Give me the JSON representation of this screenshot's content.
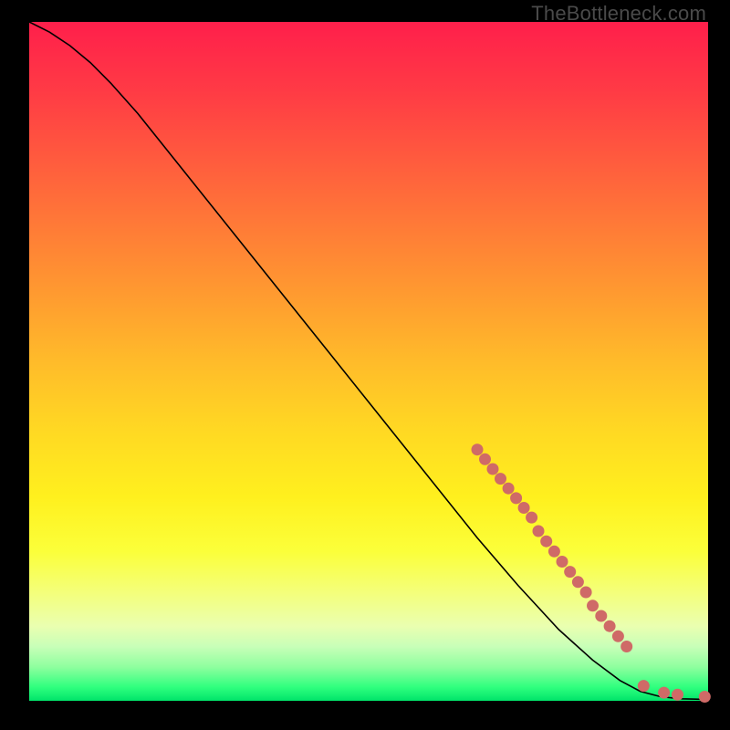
{
  "watermark": "TheBottleneck.com",
  "colors": {
    "dot": "#cf6a67",
    "line": "#000000",
    "frame": "#000000"
  },
  "chart_data": {
    "type": "line",
    "title": "",
    "xlabel": "",
    "ylabel": "",
    "xlim": [
      0,
      100
    ],
    "ylim": [
      0,
      100
    ],
    "grid": false,
    "line_points": [
      {
        "x": 0,
        "y": 100
      },
      {
        "x": 3,
        "y": 98.5
      },
      {
        "x": 6,
        "y": 96.5
      },
      {
        "x": 9,
        "y": 94.0
      },
      {
        "x": 12,
        "y": 91.0
      },
      {
        "x": 16,
        "y": 86.5
      },
      {
        "x": 22,
        "y": 79.0
      },
      {
        "x": 30,
        "y": 69.0
      },
      {
        "x": 40,
        "y": 56.5
      },
      {
        "x": 50,
        "y": 44.0
      },
      {
        "x": 58,
        "y": 34.0
      },
      {
        "x": 66,
        "y": 24.0
      },
      {
        "x": 72,
        "y": 17.0
      },
      {
        "x": 78,
        "y": 10.5
      },
      {
        "x": 83,
        "y": 6.0
      },
      {
        "x": 87,
        "y": 3.0
      },
      {
        "x": 90,
        "y": 1.4
      },
      {
        "x": 93,
        "y": 0.6
      },
      {
        "x": 96,
        "y": 0.3
      },
      {
        "x": 100,
        "y": 0.2
      }
    ],
    "dot_segments": [
      {
        "x_start": 66,
        "y_start": 37,
        "x_end": 74,
        "y_end": 27,
        "count": 8
      },
      {
        "x_start": 75,
        "y_start": 25,
        "x_end": 82,
        "y_end": 16,
        "count": 7
      },
      {
        "x_start": 83,
        "y_start": 14,
        "x_end": 88,
        "y_end": 8,
        "count": 5
      }
    ],
    "isolated_dots": [
      {
        "x": 90.5,
        "y": 2.2
      },
      {
        "x": 93.5,
        "y": 1.2
      },
      {
        "x": 95.5,
        "y": 0.9
      },
      {
        "x": 99.5,
        "y": 0.6
      }
    ],
    "dot_radius": 6.5
  }
}
